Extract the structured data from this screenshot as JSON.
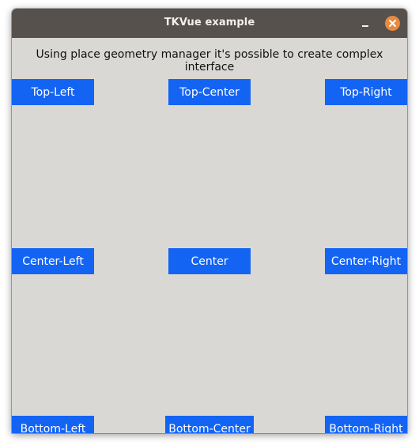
{
  "window": {
    "title": "TKVue example"
  },
  "description": "Using place geometry manager it's possible to create complex interface",
  "buttons": {
    "top_left": "Top-Left",
    "top_center": "Top-Center",
    "top_right": "Top-Right",
    "center_left": "Center-Left",
    "center": "Center",
    "center_right": "Center-Right",
    "bottom_left": "Bottom-Left",
    "bottom_center": "Bottom-Center",
    "bottom_right": "Bottom-Right"
  },
  "colors": {
    "titlebar": "#57514e",
    "window_bg": "#dad8d4",
    "button_bg": "#1464f4",
    "button_text": "#ffffff",
    "close_button": "#e88a3f"
  },
  "icons": {
    "minimize": "minimize-icon",
    "close": "close-icon"
  }
}
